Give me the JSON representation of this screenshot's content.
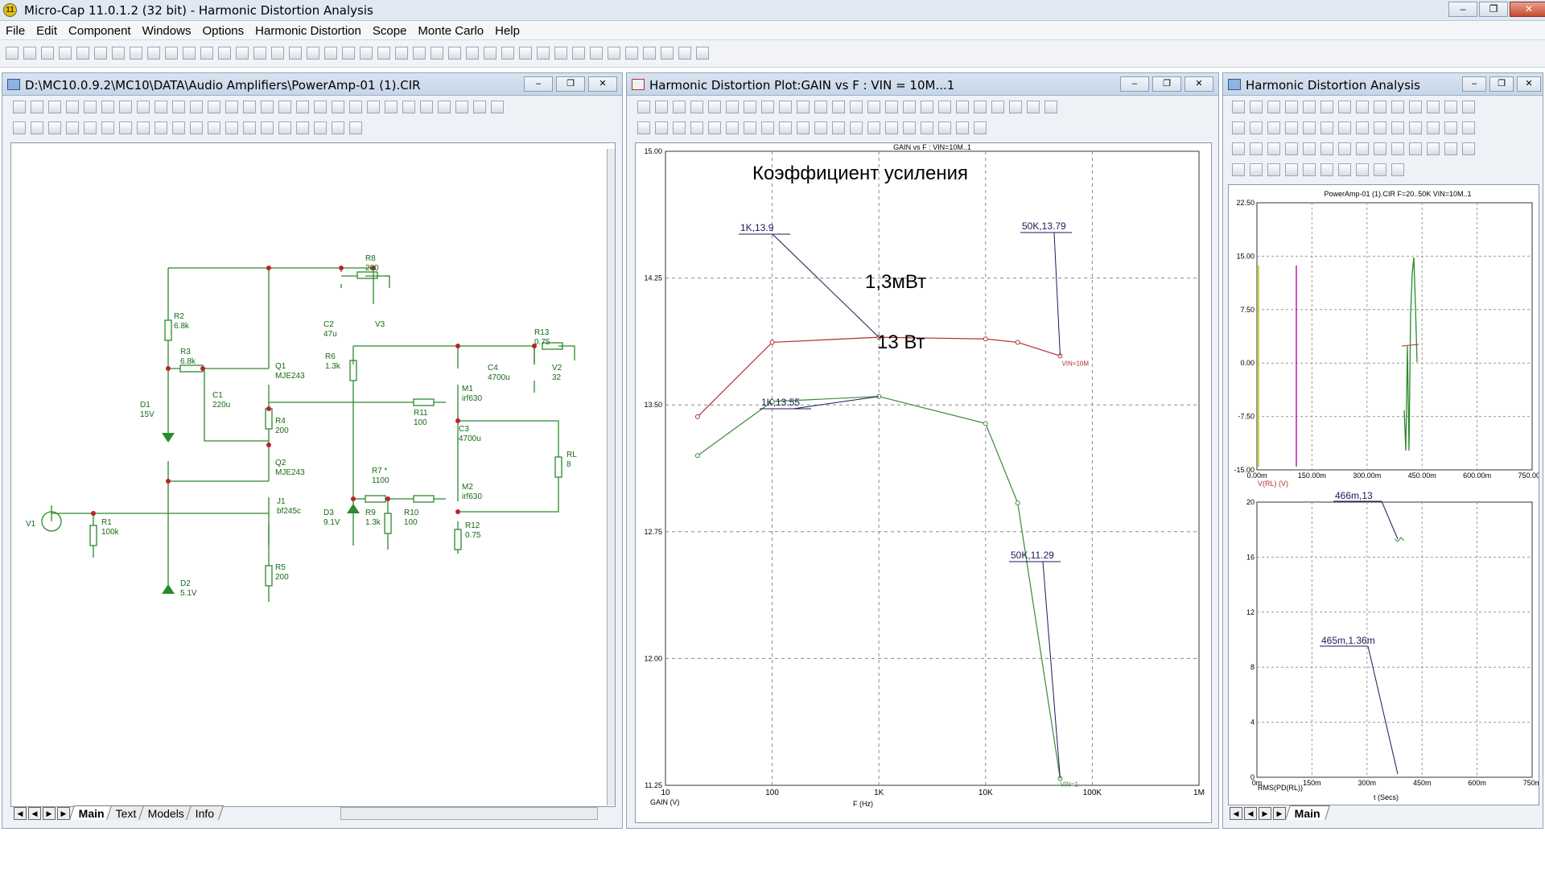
{
  "app": {
    "title": "Micro-Cap 11.0.1.2 (32 bit) - Harmonic Distortion Analysis",
    "icon_glyph": "11"
  },
  "menu": [
    "File",
    "Edit",
    "Component",
    "Windows",
    "Options",
    "Harmonic Distortion",
    "Scope",
    "Monte Carlo",
    "Help"
  ],
  "schematic_window": {
    "title": "D:\\MC10.0.9.2\\MC10\\DATA\\Audio Amplifiers\\PowerAmp-01 (1).CIR",
    "tabs": [
      "Main",
      "Text",
      "Models",
      "Info"
    ],
    "active_tab": "Main",
    "components": {
      "r2": [
        "R2",
        "6.8k"
      ],
      "r8": [
        "R8",
        "200"
      ],
      "c2": [
        "C2",
        "47u"
      ],
      "v3": [
        "V3"
      ],
      "r3": [
        "R3",
        "6.8k"
      ],
      "q1": [
        "Q1",
        "MJE243"
      ],
      "r13": [
        "R13",
        "0.75"
      ],
      "r6": [
        "R6",
        "1.3k"
      ],
      "c4": [
        "C4",
        "4700u"
      ],
      "v2": [
        "V2",
        "32"
      ],
      "d1": [
        "D1",
        "15V"
      ],
      "c1": [
        "C1",
        "220u"
      ],
      "m1": [
        "M1",
        "irf630"
      ],
      "r11": [
        "R11",
        "100"
      ],
      "r4": [
        "R4",
        "200"
      ],
      "c3": [
        "C3",
        "4700u"
      ],
      "rl": [
        "RL",
        "8"
      ],
      "q2": [
        "Q2",
        "MJE243"
      ],
      "r7": [
        "R7 *",
        "1100"
      ],
      "m2": [
        "M2",
        "irf630"
      ],
      "j1": [
        "J1",
        "bf245c"
      ],
      "d3": [
        "D3",
        "9.1V"
      ],
      "r9": [
        "R9",
        "1.3k"
      ],
      "r10": [
        "R10",
        "100"
      ],
      "v1": [
        "V1"
      ],
      "r1": [
        "R1",
        "100k"
      ],
      "r12": [
        "R12",
        "0.75"
      ],
      "r5": [
        "R5",
        "200"
      ],
      "d2": [
        "D2",
        "5.1V"
      ]
    }
  },
  "hd_plot_window": {
    "title": "Harmonic Distortion Plot:GAIN vs F : VIN = 10M...1",
    "plot_header": "GAIN vs F : VIN=10M..1",
    "annotations": {
      "heading": "Коэффициент усиления",
      "mw_label": "1,3мВт",
      "w_label": "13 Вт"
    },
    "labels": {
      "p1": "1K,13.9",
      "p2": "50K,13.79",
      "p3": "1K,13.55",
      "p4": "50K,11.29",
      "vin_top": "VIN=10M",
      "vin_bottom": "VIN=1"
    },
    "xlabel": "GAIN (V)",
    "xunit": "F (Hz)"
  },
  "hd_analysis_window": {
    "title": "Harmonic Distortion Analysis",
    "top_header": "PowerAmp-01 (1).CIR F=20..50K VIN=10M..1",
    "top_ylabel": "V(RL) (V)",
    "bottom_ylabel": "RMS(PD(RL))",
    "bottom_xlabel": "t (Secs)",
    "labels": {
      "a": "466m,13",
      "b": "465m,1.36m"
    },
    "tabs": [
      "Main"
    ],
    "active_tab": "Main"
  },
  "chart_data": [
    {
      "type": "line",
      "title": "GAIN vs F : VIN=10M..1",
      "xlabel": "F (Hz)",
      "ylabel": "GAIN (V)",
      "x_scale": "log",
      "xlim": [
        10,
        1000000
      ],
      "ylim": [
        11.25,
        15.0
      ],
      "x_ticks": [
        "10",
        "100",
        "1K",
        "10K",
        "100K",
        "1M"
      ],
      "y_ticks": [
        "11.25",
        "12.00",
        "12.75",
        "13.50",
        "14.25",
        "15.00"
      ],
      "grid": true,
      "colors": [
        "#b03030",
        "#3a8a3a"
      ],
      "x": [
        20,
        100,
        1000,
        10000,
        20000,
        50000
      ],
      "series": [
        {
          "name": "VIN=10M",
          "values": [
            13.43,
            13.87,
            13.9,
            13.89,
            13.87,
            13.79
          ]
        },
        {
          "name": "VIN=1",
          "values": [
            13.2,
            13.52,
            13.55,
            13.39,
            12.92,
            11.29
          ]
        }
      ]
    },
    {
      "type": "line",
      "title": "PowerAmp-01 (1).CIR F=20..50K VIN=10M..1",
      "xlabel": "",
      "ylabel": "V(RL) (V)",
      "xlim": [
        0,
        0.75
      ],
      "ylim": [
        -15,
        22.5
      ],
      "x_ticks": [
        "0.00m",
        "150.00m",
        "300.00m",
        "450.00m",
        "600.00m",
        "750.00m"
      ],
      "y_ticks": [
        "-15.00",
        "-7.50",
        "0.00",
        "7.50",
        "15.00",
        "22.50"
      ],
      "grid": true
    },
    {
      "type": "line",
      "title": "",
      "xlabel": "t (Secs)",
      "ylabel": "RMS(PD(RL))",
      "xlim": [
        0,
        0.75
      ],
      "ylim": [
        0,
        20
      ],
      "x_ticks": [
        "0m",
        "150m",
        "300m",
        "450m",
        "600m",
        "750m"
      ],
      "y_ticks": [
        "0",
        "4",
        "8",
        "12",
        "16",
        "20"
      ],
      "grid": true
    }
  ]
}
